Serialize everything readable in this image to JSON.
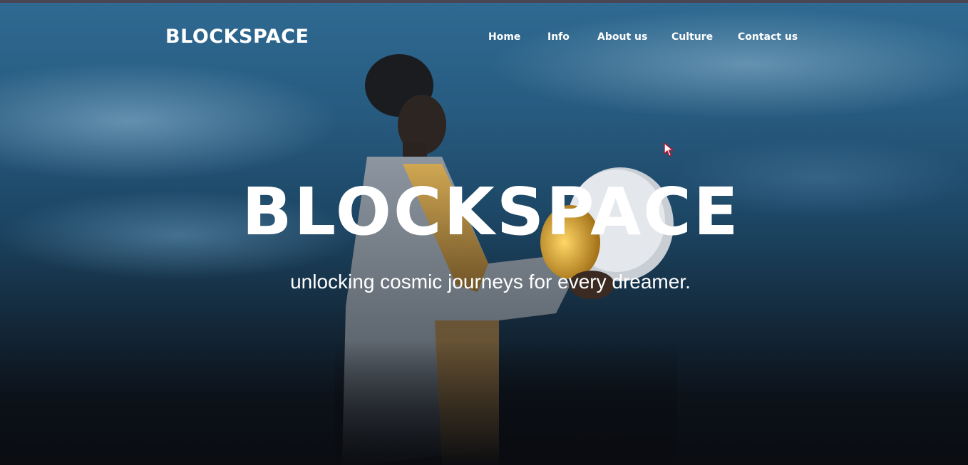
{
  "header": {
    "brand": "BLOCKSPACE",
    "nav": [
      {
        "label": "Home"
      },
      {
        "label": "Info"
      },
      {
        "label": "About us"
      },
      {
        "label": "Culture"
      },
      {
        "label": "Contact us"
      }
    ]
  },
  "hero": {
    "title": "BLOCKSPACE",
    "subtitle": "unlocking cosmic journeys for every dreamer.",
    "image": "astronaut-holding-helmet"
  },
  "colors": {
    "text": "#ffffff",
    "sky_top": "#2f6a92",
    "sky_bottom": "#0a0c11",
    "suit_accent": "#c99a3a"
  },
  "icons": {
    "cursor": "mouse-pointer-icon"
  }
}
